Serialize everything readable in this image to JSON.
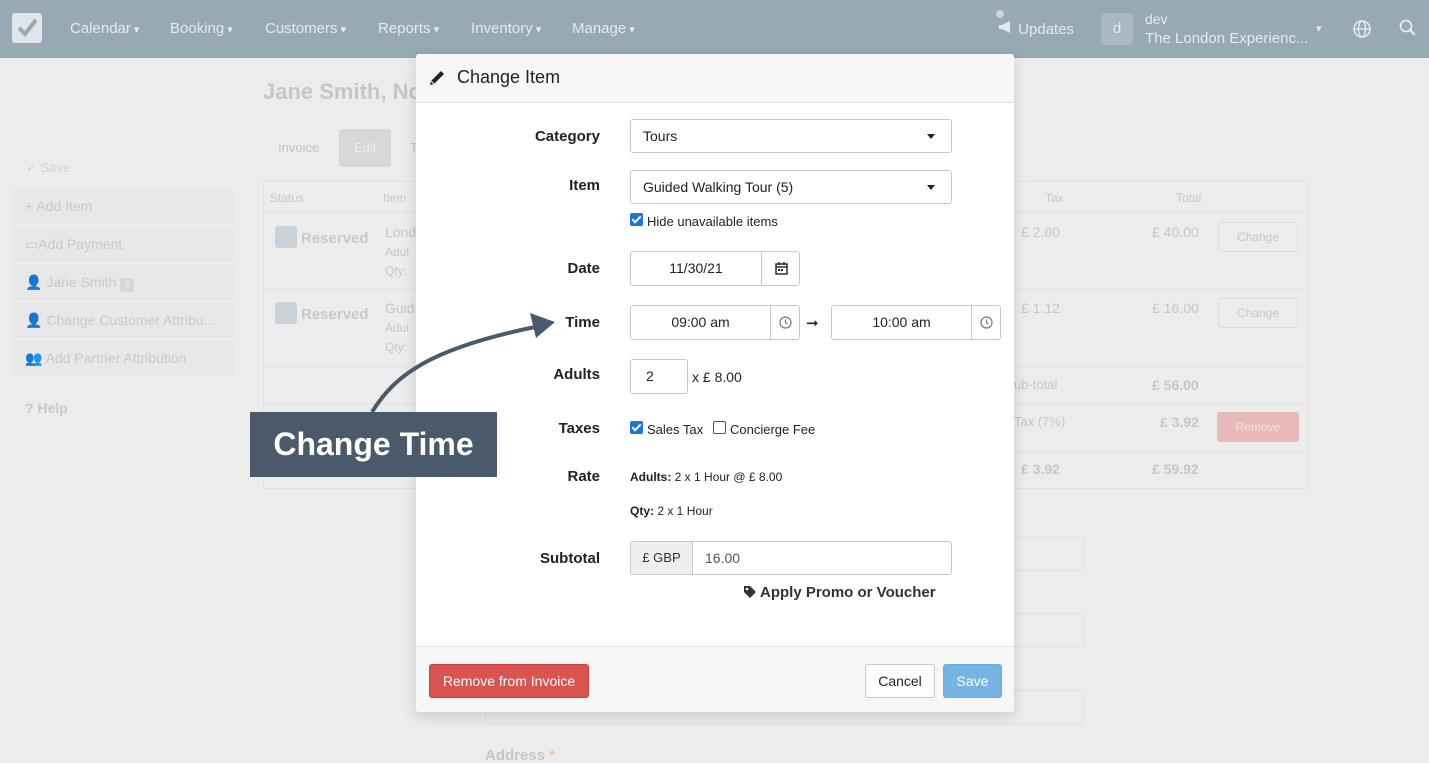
{
  "topnav": {
    "items": [
      "Calendar",
      "Booking",
      "Customers",
      "Reports",
      "Inventory",
      "Manage"
    ],
    "updates": "Updates",
    "avatar_letter": "d",
    "user": "dev",
    "org": "The London Experienc..."
  },
  "page": {
    "title": "Jane Smith, No",
    "tabs": [
      "Invoice",
      "Edit",
      "T"
    ],
    "sidebar": [
      "+ Add Item",
      "Add Payment",
      "Jane Smith",
      "Change Customer Attribu...",
      "Add Partner Attribution",
      "Help"
    ],
    "sidebar_badge": "4",
    "save_label": "Save",
    "table_headers": {
      "status": "Status",
      "item": "Item",
      "tax": "Tax",
      "total": "Total"
    },
    "rows": [
      {
        "status": "Reserved",
        "item": "Lond",
        "line2": "Adul",
        "line3": "Qty:",
        "tax": "£ 2.80",
        "total": "£ 40.00",
        "action": "Change"
      },
      {
        "status": "Reserved",
        "item": "Guid",
        "line2": "Adul",
        "line3": "Qty:",
        "tax": "£ 1.12",
        "total": "£ 16.00",
        "action": "Change"
      }
    ],
    "subtotal_label": "ub-total",
    "subtotal_value": "£ 56.00",
    "tax_label": "Tax (7%)",
    "tax_value": "£ 3.92",
    "remove_label": "Remove",
    "total_tax": "£ 3.92",
    "grand_total": "£ 59.92",
    "address_label": "Address",
    "required_mark": "*"
  },
  "modal": {
    "title": "Change Item",
    "category_label": "Category",
    "category_value": "Tours",
    "item_label": "Item",
    "item_value": "Guided Walking Tour (5)",
    "hide_unavailable": "Hide unavailable items",
    "date_label": "Date",
    "date_value": "11/30/21",
    "time_label": "Time",
    "time_start": "09:00 am",
    "time_end": "10:00 am",
    "adults_label": "Adults",
    "adults_value": "2",
    "adults_price": "x £ 8.00",
    "taxes_label": "Taxes",
    "tax_sales": "Sales Tax",
    "tax_concierge": "Concierge Fee",
    "rate_label": "Rate",
    "rate_adults_key": "Adults:",
    "rate_adults_val": "2 x 1 Hour @ £ 8.00",
    "rate_qty_key": "Qty:",
    "rate_qty_val": "2 x 1 Hour",
    "subtotal_label": "Subtotal",
    "currency": "£ GBP",
    "subtotal_value": "16.00",
    "promo": "Apply Promo or Voucher",
    "remove_button": "Remove from Invoice",
    "cancel_button": "Cancel",
    "save_button": "Save"
  },
  "annotation": {
    "callout": "Change Time"
  },
  "colors": {
    "callout_bg": "#4a5a6a",
    "danger": "#d9534f",
    "primary": "#75b4e3",
    "nav_bg": "#97a9b4"
  }
}
